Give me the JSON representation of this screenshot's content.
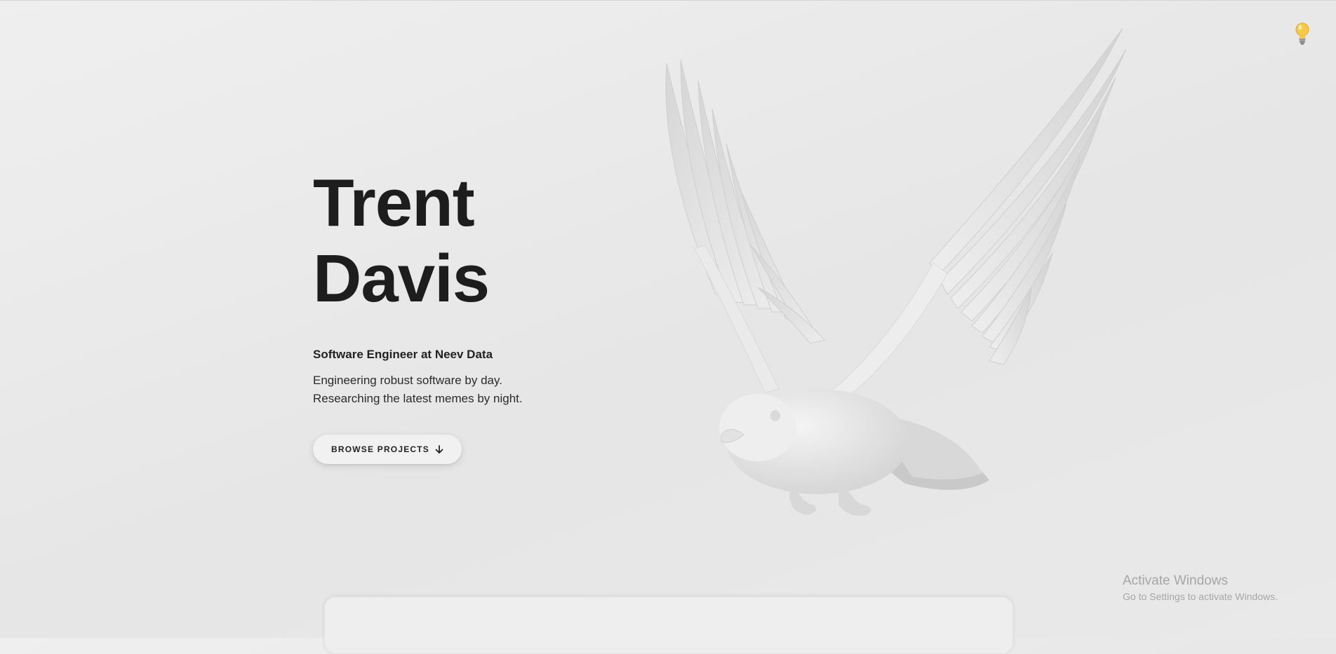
{
  "hero": {
    "name_first": "Trent",
    "name_last": "Davis",
    "role": "Software Engineer at Neev Data",
    "tagline_line1": "Engineering robust software by day.",
    "tagline_line2": "Researching the latest memes by night.",
    "browse_label": "BROWSE PROJECTS",
    "browse_icon": "arrow-down-icon"
  },
  "theme_toggle": {
    "icon": "lightbulb-icon",
    "color": "#f5c542"
  },
  "illustration": {
    "icon": "bird-3d-illustration"
  },
  "watermark": {
    "title": "Activate Windows",
    "subtitle": "Go to Settings to activate Windows."
  },
  "colors": {
    "background": "#e9e9e9",
    "text": "#1d1d1d",
    "button_bg": "#f1f1f1"
  }
}
